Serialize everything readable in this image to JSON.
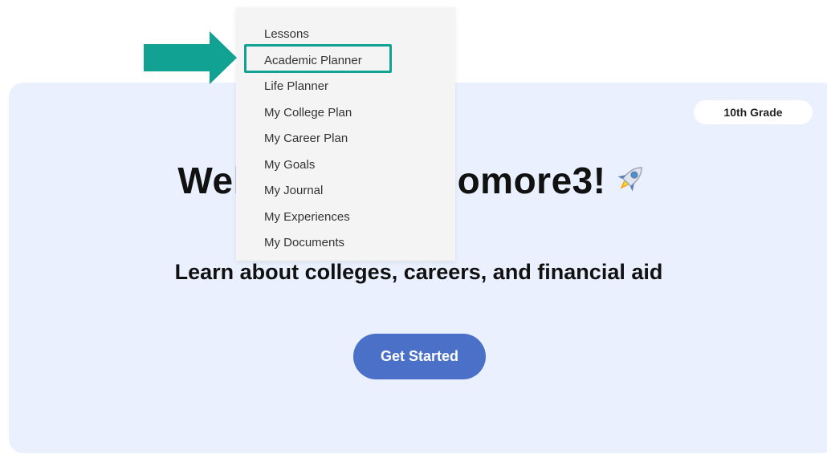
{
  "hero": {
    "grade_badge": "10th Grade",
    "heading": "Welcome, Sophomore3!",
    "subtitle": "Learn about colleges, careers, and financial aid",
    "cta_label": "Get Started"
  },
  "menu": {
    "items": [
      {
        "label": "Lessons"
      },
      {
        "label": "Academic Planner"
      },
      {
        "label": "Life Planner"
      },
      {
        "label": "My College Plan"
      },
      {
        "label": "My Career Plan"
      },
      {
        "label": "My Goals"
      },
      {
        "label": "My Journal"
      },
      {
        "label": "My Experiences"
      },
      {
        "label": "My Documents"
      }
    ],
    "highlighted_index": 1
  },
  "colors": {
    "hero_bg": "#eaf0fd",
    "cta_bg": "#4a70c7",
    "highlight": "#11a294",
    "menu_bg": "#f4f4f4"
  },
  "icons": {
    "rocket": "rocket-icon",
    "arrow": "arrow-right-icon"
  }
}
